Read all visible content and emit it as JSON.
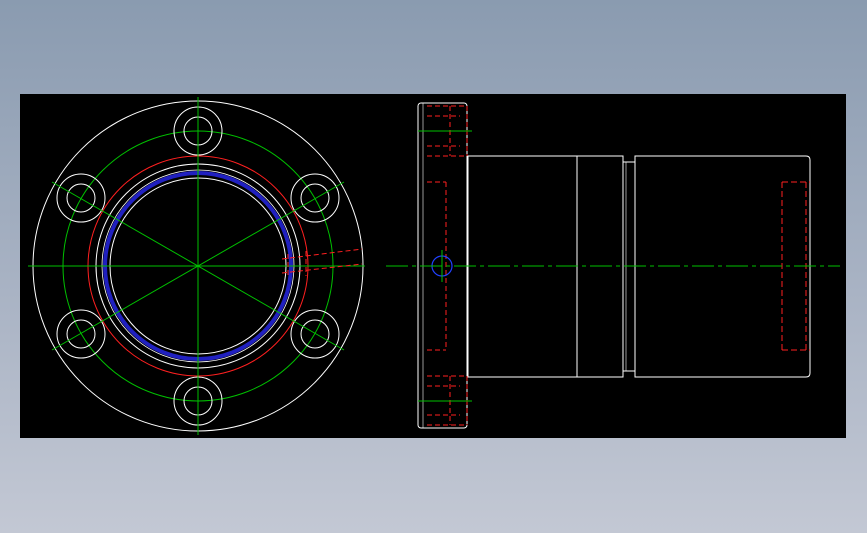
{
  "background": {
    "gradient_top": "#8a9bb0",
    "gradient_bottom": "#c3c8d4"
  },
  "cad_view": {
    "background_color": "#000000",
    "layers": {
      "outline": "#ffffff",
      "centerline": "#00c000",
      "hidden": "#ff2020",
      "bore_groove": "#2020c0"
    },
    "front_view": {
      "flange": "circle",
      "bolt_hole_count": 6,
      "bolt_hole_pattern": "bolt-circle",
      "bore_with_groove": true
    },
    "side_view": {
      "flange": "plate",
      "body": "cylinder-with-relief-groove",
      "cross_hole": true
    }
  }
}
